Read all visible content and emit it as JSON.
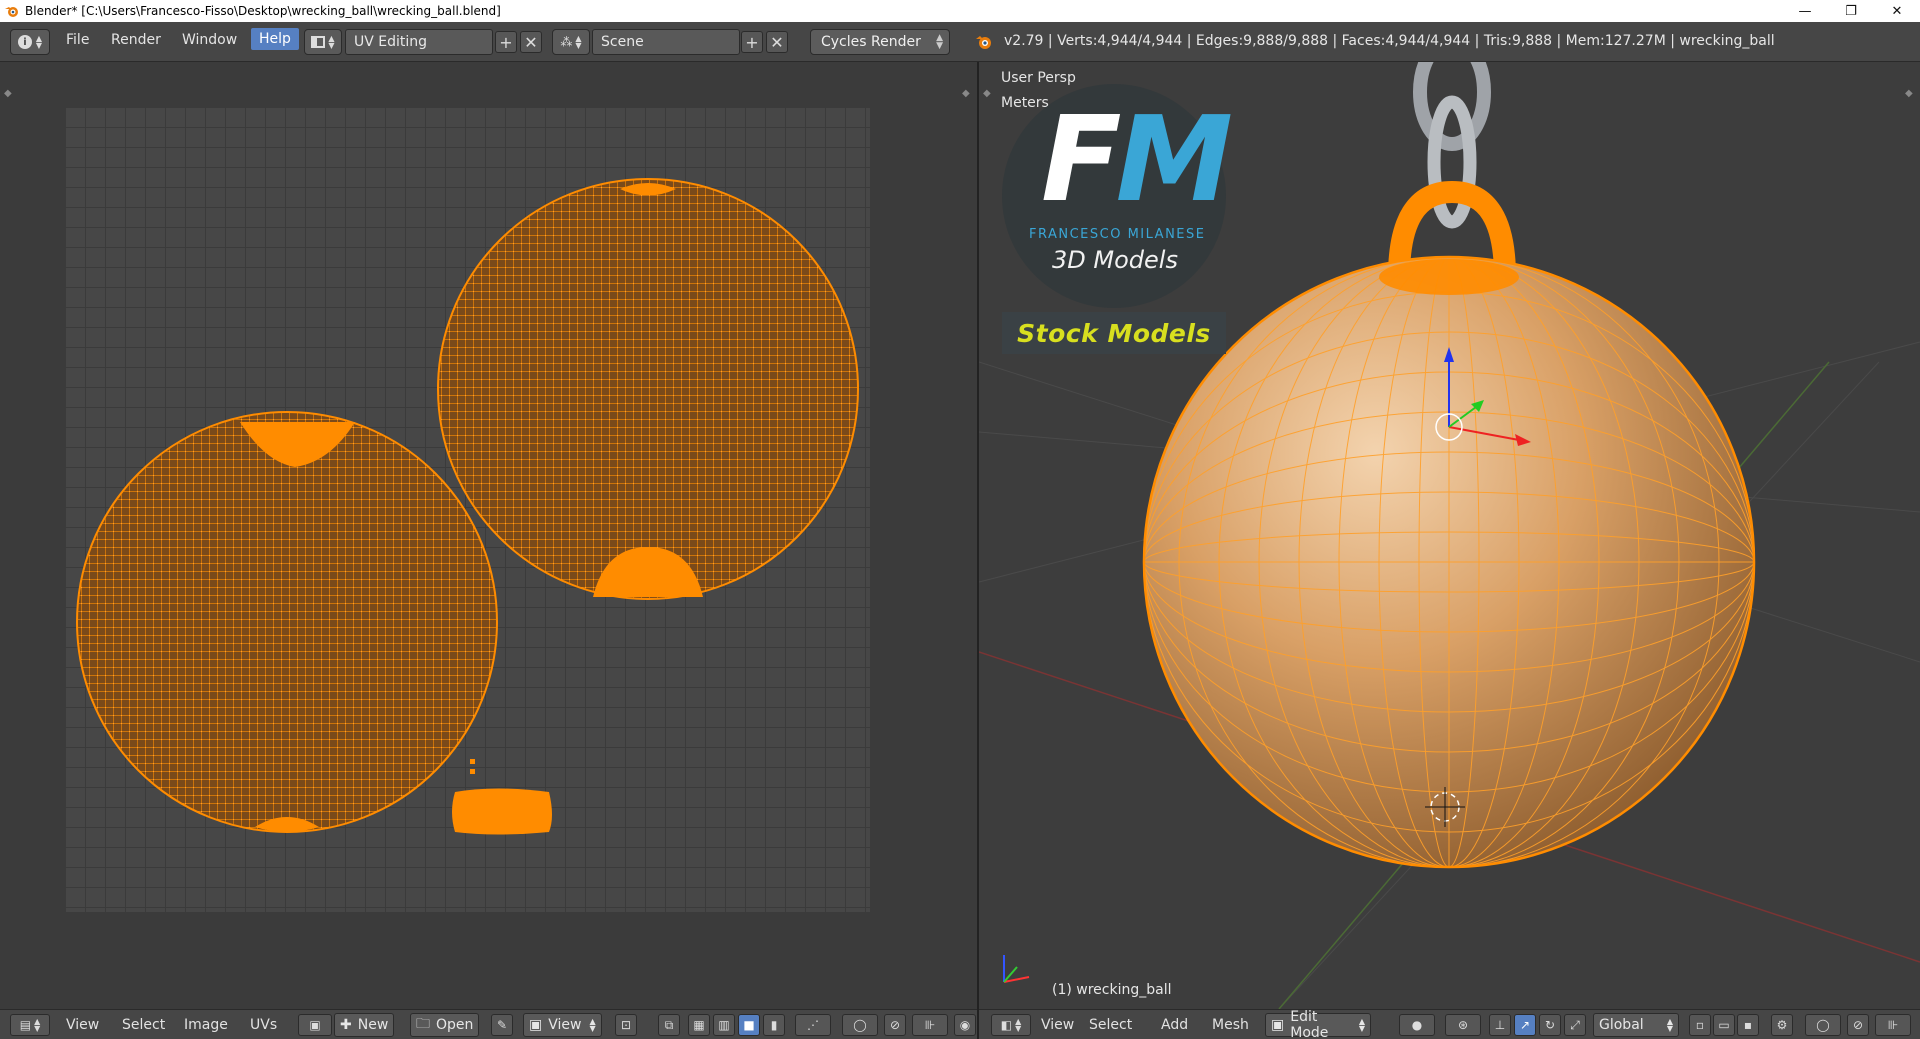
{
  "window": {
    "title": "Blender* [C:\\Users\\Francesco-Fisso\\Desktop\\wrecking_ball\\wrecking_ball.blend]",
    "minimize_glyph": "—",
    "restore_glyph": "❐",
    "close_glyph": "✕"
  },
  "info_header": {
    "menus": [
      "File",
      "Render",
      "Window",
      "Help"
    ],
    "active_menu": "Help",
    "screen_layout": "UV Editing",
    "scene": "Scene",
    "render_engine": "Cycles Render",
    "stats": "v2.79 | Verts:4,944/4,944 | Edges:9,888/9,888 | Faces:4,944/4,944 | Tris:9,888 | Mem:127.27M | wrecking_ball"
  },
  "uv_editor": {
    "header": {
      "menus": [
        "View",
        "Select",
        "Image",
        "UVs"
      ],
      "new_label": "New",
      "open_label": "Open",
      "view_label": "View"
    }
  },
  "viewport": {
    "view_name": "User Persp",
    "units": "Meters",
    "object_label": "(1) wrecking_ball",
    "logo": {
      "letter_f": "F",
      "letter_m": "M",
      "name": "FRANCESCO MILANESE",
      "subtitle": "3D Models",
      "banner": "Stock Models"
    },
    "header": {
      "menus": [
        "View",
        "Select",
        "Add",
        "Mesh"
      ],
      "mode": "Edit Mode",
      "orientation": "Global"
    }
  },
  "colors": {
    "accent": "#5680c2",
    "selection": "#ff8c00",
    "mesh": "#d9a066"
  }
}
